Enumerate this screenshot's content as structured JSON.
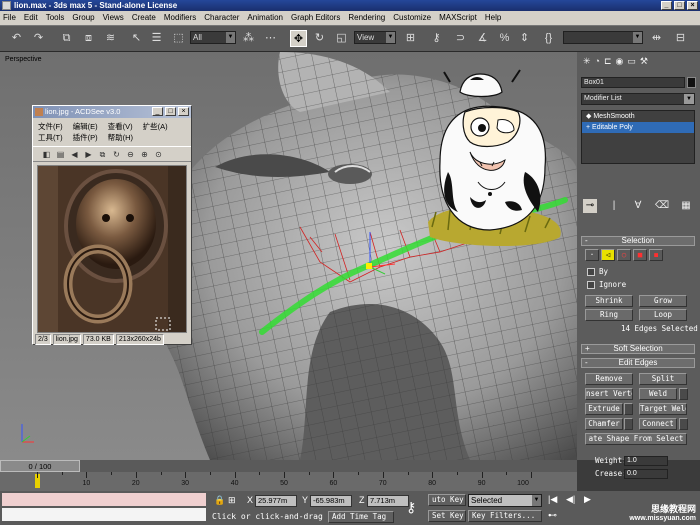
{
  "app": {
    "title": "lion.max - 3ds max 5 - Stand-alone License"
  },
  "menu": [
    "File",
    "Edit",
    "Tools",
    "Group",
    "Views",
    "Create",
    "Modifiers",
    "Character",
    "Animation",
    "Graph Editors",
    "Rendering",
    "Customize",
    "MAXScript",
    "Help"
  ],
  "toolbar": {
    "selection_filter": "All",
    "ref_coord": "View"
  },
  "viewport": {
    "label": "Perspective"
  },
  "command_panel": {
    "object_name": "Box01",
    "modifier_list": "Modifier List",
    "stack": [
      "MeshSmooth",
      "Editable Poly"
    ],
    "selection": {
      "title": "Selection",
      "by_label": "By",
      "ignore_label": "Ignore",
      "shrink": "Shrink",
      "grow": "Grow",
      "ring": "Ring",
      "loop": "Loop",
      "status": "14 Edges Selected"
    },
    "soft_selection": {
      "title": "Soft Selection"
    },
    "edit_edges": {
      "title": "Edit Edges",
      "remove": "Remove",
      "split": "Split",
      "insert_vertex": "nsert Verte",
      "weld": "Weld",
      "extrude": "Extrude",
      "target_weld": "Target Weld",
      "chamfer": "Chamfer",
      "connect": "Connect",
      "create_shape": "ate Shape From Select",
      "weight_label": "Weight:",
      "weight_value": "1.0",
      "crease_label": "Crease:",
      "crease_value": "0.0"
    }
  },
  "timeline": {
    "slider": "0 / 100",
    "ticks": [
      "10",
      "20",
      "30",
      "40",
      "50",
      "60",
      "70",
      "80",
      "90",
      "100"
    ]
  },
  "status": {
    "x_label": "X",
    "x_value": "25.977m",
    "y_label": "Y",
    "y_value": "-65.983m",
    "z_label": "Z",
    "z_value": "7.713m",
    "prompt": "Click or click-and-drag",
    "add_time_tag": "Add Time Tag",
    "auto_key": "uto Key",
    "key_mode": "Selected",
    "set_key": "Set Key",
    "key_filters": "Key Filters..."
  },
  "acdsee": {
    "title": "lion.jpg - ACDSee v3.0",
    "menu": [
      "文件(F)",
      "编辑(E)",
      "查看(V)",
      "扩些(A)",
      "工具(T)",
      "插件(P)",
      "帮助(H)"
    ],
    "status": [
      "2/3",
      "lion.jpg",
      "73.0 KB",
      "213x260x24b"
    ]
  },
  "watermark": {
    "line1": "思缘教程网",
    "line2": "www.missyuan.com"
  },
  "colors": {
    "selected": "#2f6bb6",
    "highlight_path": "#33dd33",
    "edge_sel": "#d22222"
  }
}
